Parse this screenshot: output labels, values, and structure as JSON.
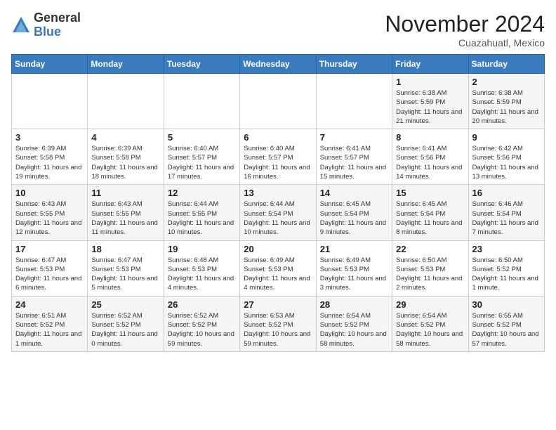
{
  "header": {
    "logo": {
      "general": "General",
      "blue": "Blue"
    },
    "title": "November 2024",
    "location": "Cuazahuatl, Mexico"
  },
  "weekdays": [
    "Sunday",
    "Monday",
    "Tuesday",
    "Wednesday",
    "Thursday",
    "Friday",
    "Saturday"
  ],
  "weeks": [
    [
      {
        "day": "",
        "sunrise": "",
        "sunset": "",
        "daylight": ""
      },
      {
        "day": "",
        "sunrise": "",
        "sunset": "",
        "daylight": ""
      },
      {
        "day": "",
        "sunrise": "",
        "sunset": "",
        "daylight": ""
      },
      {
        "day": "",
        "sunrise": "",
        "sunset": "",
        "daylight": ""
      },
      {
        "day": "",
        "sunrise": "",
        "sunset": "",
        "daylight": ""
      },
      {
        "day": "1",
        "sunrise": "Sunrise: 6:38 AM",
        "sunset": "Sunset: 5:59 PM",
        "daylight": "Daylight: 11 hours and 21 minutes."
      },
      {
        "day": "2",
        "sunrise": "Sunrise: 6:38 AM",
        "sunset": "Sunset: 5:59 PM",
        "daylight": "Daylight: 11 hours and 20 minutes."
      }
    ],
    [
      {
        "day": "3",
        "sunrise": "Sunrise: 6:39 AM",
        "sunset": "Sunset: 5:58 PM",
        "daylight": "Daylight: 11 hours and 19 minutes."
      },
      {
        "day": "4",
        "sunrise": "Sunrise: 6:39 AM",
        "sunset": "Sunset: 5:58 PM",
        "daylight": "Daylight: 11 hours and 18 minutes."
      },
      {
        "day": "5",
        "sunrise": "Sunrise: 6:40 AM",
        "sunset": "Sunset: 5:57 PM",
        "daylight": "Daylight: 11 hours and 17 minutes."
      },
      {
        "day": "6",
        "sunrise": "Sunrise: 6:40 AM",
        "sunset": "Sunset: 5:57 PM",
        "daylight": "Daylight: 11 hours and 16 minutes."
      },
      {
        "day": "7",
        "sunrise": "Sunrise: 6:41 AM",
        "sunset": "Sunset: 5:57 PM",
        "daylight": "Daylight: 11 hours and 15 minutes."
      },
      {
        "day": "8",
        "sunrise": "Sunrise: 6:41 AM",
        "sunset": "Sunset: 5:56 PM",
        "daylight": "Daylight: 11 hours and 14 minutes."
      },
      {
        "day": "9",
        "sunrise": "Sunrise: 6:42 AM",
        "sunset": "Sunset: 5:56 PM",
        "daylight": "Daylight: 11 hours and 13 minutes."
      }
    ],
    [
      {
        "day": "10",
        "sunrise": "Sunrise: 6:43 AM",
        "sunset": "Sunset: 5:55 PM",
        "daylight": "Daylight: 11 hours and 12 minutes."
      },
      {
        "day": "11",
        "sunrise": "Sunrise: 6:43 AM",
        "sunset": "Sunset: 5:55 PM",
        "daylight": "Daylight: 11 hours and 11 minutes."
      },
      {
        "day": "12",
        "sunrise": "Sunrise: 6:44 AM",
        "sunset": "Sunset: 5:55 PM",
        "daylight": "Daylight: 11 hours and 10 minutes."
      },
      {
        "day": "13",
        "sunrise": "Sunrise: 6:44 AM",
        "sunset": "Sunset: 5:54 PM",
        "daylight": "Daylight: 11 hours and 10 minutes."
      },
      {
        "day": "14",
        "sunrise": "Sunrise: 6:45 AM",
        "sunset": "Sunset: 5:54 PM",
        "daylight": "Daylight: 11 hours and 9 minutes."
      },
      {
        "day": "15",
        "sunrise": "Sunrise: 6:45 AM",
        "sunset": "Sunset: 5:54 PM",
        "daylight": "Daylight: 11 hours and 8 minutes."
      },
      {
        "day": "16",
        "sunrise": "Sunrise: 6:46 AM",
        "sunset": "Sunset: 5:54 PM",
        "daylight": "Daylight: 11 hours and 7 minutes."
      }
    ],
    [
      {
        "day": "17",
        "sunrise": "Sunrise: 6:47 AM",
        "sunset": "Sunset: 5:53 PM",
        "daylight": "Daylight: 11 hours and 6 minutes."
      },
      {
        "day": "18",
        "sunrise": "Sunrise: 6:47 AM",
        "sunset": "Sunset: 5:53 PM",
        "daylight": "Daylight: 11 hours and 5 minutes."
      },
      {
        "day": "19",
        "sunrise": "Sunrise: 6:48 AM",
        "sunset": "Sunset: 5:53 PM",
        "daylight": "Daylight: 11 hours and 4 minutes."
      },
      {
        "day": "20",
        "sunrise": "Sunrise: 6:49 AM",
        "sunset": "Sunset: 5:53 PM",
        "daylight": "Daylight: 11 hours and 4 minutes."
      },
      {
        "day": "21",
        "sunrise": "Sunrise: 6:49 AM",
        "sunset": "Sunset: 5:53 PM",
        "daylight": "Daylight: 11 hours and 3 minutes."
      },
      {
        "day": "22",
        "sunrise": "Sunrise: 6:50 AM",
        "sunset": "Sunset: 5:53 PM",
        "daylight": "Daylight: 11 hours and 2 minutes."
      },
      {
        "day": "23",
        "sunrise": "Sunrise: 6:50 AM",
        "sunset": "Sunset: 5:52 PM",
        "daylight": "Daylight: 11 hours and 1 minute."
      }
    ],
    [
      {
        "day": "24",
        "sunrise": "Sunrise: 6:51 AM",
        "sunset": "Sunset: 5:52 PM",
        "daylight": "Daylight: 11 hours and 1 minute."
      },
      {
        "day": "25",
        "sunrise": "Sunrise: 6:52 AM",
        "sunset": "Sunset: 5:52 PM",
        "daylight": "Daylight: 11 hours and 0 minutes."
      },
      {
        "day": "26",
        "sunrise": "Sunrise: 6:52 AM",
        "sunset": "Sunset: 5:52 PM",
        "daylight": "Daylight: 10 hours and 59 minutes."
      },
      {
        "day": "27",
        "sunrise": "Sunrise: 6:53 AM",
        "sunset": "Sunset: 5:52 PM",
        "daylight": "Daylight: 10 hours and 59 minutes."
      },
      {
        "day": "28",
        "sunrise": "Sunrise: 6:54 AM",
        "sunset": "Sunset: 5:52 PM",
        "daylight": "Daylight: 10 hours and 58 minutes."
      },
      {
        "day": "29",
        "sunrise": "Sunrise: 6:54 AM",
        "sunset": "Sunset: 5:52 PM",
        "daylight": "Daylight: 10 hours and 58 minutes."
      },
      {
        "day": "30",
        "sunrise": "Sunrise: 6:55 AM",
        "sunset": "Sunset: 5:52 PM",
        "daylight": "Daylight: 10 hours and 57 minutes."
      }
    ]
  ]
}
